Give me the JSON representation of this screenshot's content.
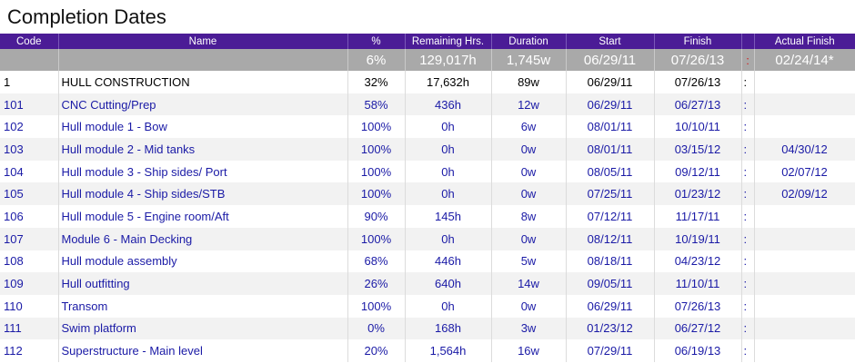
{
  "page_title": "Completion Dates",
  "columns": [
    "Code",
    "Name",
    "%",
    "Remaining Hrs.",
    "Duration",
    "Start",
    "Finish",
    "",
    "Actual Finish"
  ],
  "summary": {
    "percent": "6%",
    "remaining": "129,017h",
    "duration": "1,745w",
    "start": "06/29/11",
    "finish": "07/26/13",
    "colon": ":",
    "actual": "02/24/14*"
  },
  "rows": [
    {
      "code": "1",
      "name": "HULL CONSTRUCTION",
      "percent": "32%",
      "remaining": "17,632h",
      "duration": "89w",
      "start": "06/29/11",
      "finish": "07/26/13",
      "colon": ":",
      "actual": ""
    },
    {
      "code": "101",
      "name": "CNC Cutting/Prep",
      "percent": "58%",
      "remaining": "436h",
      "duration": "12w",
      "start": "06/29/11",
      "finish": "06/27/13",
      "colon": ":",
      "actual": ""
    },
    {
      "code": "102",
      "name": "Hull module 1 - Bow",
      "percent": "100%",
      "remaining": "0h",
      "duration": "6w",
      "start": "08/01/11",
      "finish": "10/10/11",
      "colon": ":",
      "actual": ""
    },
    {
      "code": "103",
      "name": "Hull module 2 - Mid tanks",
      "percent": "100%",
      "remaining": "0h",
      "duration": "0w",
      "start": "08/01/11",
      "finish": "03/15/12",
      "colon": ":",
      "actual": "04/30/12"
    },
    {
      "code": "104",
      "name": "Hull module 3 - Ship sides/ Port",
      "percent": "100%",
      "remaining": "0h",
      "duration": "0w",
      "start": "08/05/11",
      "finish": "09/12/11",
      "colon": ":",
      "actual": "02/07/12"
    },
    {
      "code": "105",
      "name": "Hull module 4 - Ship sides/STB",
      "percent": "100%",
      "remaining": "0h",
      "duration": "0w",
      "start": "07/25/11",
      "finish": "01/23/12",
      "colon": ":",
      "actual": "02/09/12"
    },
    {
      "code": "106",
      "name": "Hull module 5 - Engine room/Aft",
      "percent": "90%",
      "remaining": "145h",
      "duration": "8w",
      "start": "07/12/11",
      "finish": "11/17/11",
      "colon": ":",
      "actual": ""
    },
    {
      "code": "107",
      "name": "Module 6 - Main Decking",
      "percent": "100%",
      "remaining": "0h",
      "duration": "0w",
      "start": "08/12/11",
      "finish": "10/19/11",
      "colon": ":",
      "actual": ""
    },
    {
      "code": "108",
      "name": "Hull module assembly",
      "percent": "68%",
      "remaining": "446h",
      "duration": "5w",
      "start": "08/18/11",
      "finish": "04/23/12",
      "colon": ":",
      "actual": ""
    },
    {
      "code": "109",
      "name": "Hull outfitting",
      "percent": "26%",
      "remaining": "640h",
      "duration": "14w",
      "start": "09/05/11",
      "finish": "11/10/11",
      "colon": ":",
      "actual": ""
    },
    {
      "code": "110",
      "name": "Transom",
      "percent": "100%",
      "remaining": "0h",
      "duration": "0w",
      "start": "06/29/11",
      "finish": "07/26/13",
      "colon": ":",
      "actual": ""
    },
    {
      "code": "111",
      "name": "Swim platform",
      "percent": "0%",
      "remaining": "168h",
      "duration": "3w",
      "start": "01/23/12",
      "finish": "06/27/12",
      "colon": ":",
      "actual": ""
    },
    {
      "code": "112",
      "name": "Superstructure - Main level",
      "percent": "20%",
      "remaining": "1,564h",
      "duration": "16w",
      "start": "07/29/11",
      "finish": "06/19/13",
      "colon": ":",
      "actual": ""
    }
  ]
}
